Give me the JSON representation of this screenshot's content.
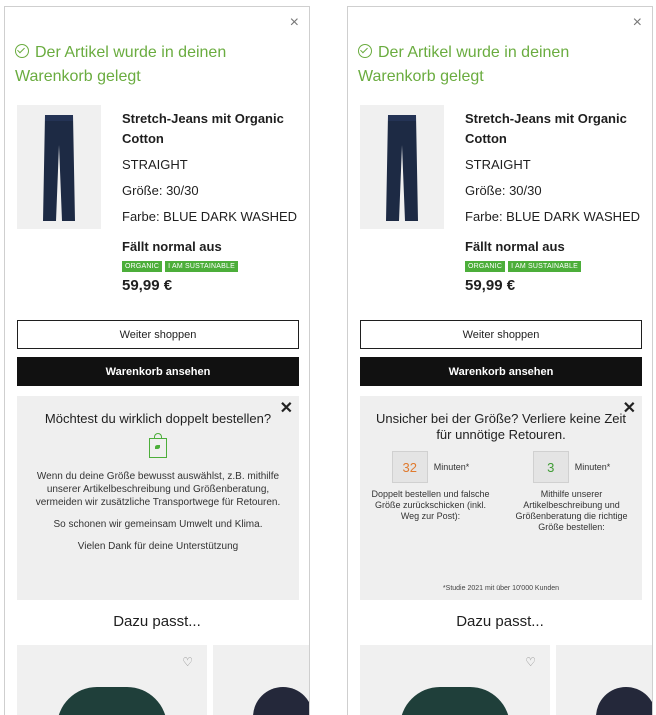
{
  "success_message": "Der Artikel wurde in deinen Warenkorb gelegt",
  "product": {
    "name": "Stretch-Jeans mit Organic Cotton",
    "fit": "STRAIGHT",
    "size_label": "Größe: 30/30",
    "color_label": "Farbe: BLUE DARK WASHED",
    "fit_note": "Fällt normal aus",
    "badges": [
      "ORGANIC",
      "I AM SUSTAINABLE"
    ],
    "price": "59,99 €"
  },
  "buttons": {
    "continue_shopping": "Weiter shoppen",
    "view_cart": "Warenkorb ansehen"
  },
  "left_box": {
    "title": "Möchtest du wirklich doppelt bestellen?",
    "paragraph1": "Wenn du deine Größe bewusst auswählst, z.B. mithilfe unserer Artikelbeschreibung und Größenberatung, vermeiden wir zusätzliche Transportwege für Retouren.",
    "paragraph2": "So schonen wir gemeinsam Umwelt und Klima.",
    "paragraph3": "Vielen Dank für deine Unterstützung"
  },
  "right_box": {
    "title": "Unsicher bei der Größe? Verliere keine Zeit für unnötige Retouren.",
    "stat1": {
      "value": "32",
      "unit": "Minuten*",
      "description": "Doppelt bestellen und falsche Größe zurückschicken (inkl. Weg zur Post):"
    },
    "stat2": {
      "value": "3",
      "unit": "Minuten*",
      "description": "Mithilfe unserer Artikelbeschreibung und Größenberatung die richtige Größe bestellen:"
    },
    "footnote": "*Studie 2021 mit über 10'000 Kunden"
  },
  "suggestions_title": "Dazu passt...",
  "colors": {
    "success_green": "#6aac3f",
    "badge_green": "#4cae3a",
    "stat_orange": "#e07a2e",
    "dark_button": "#111111",
    "info_box_bg": "#efefef"
  },
  "icons": {
    "close": "close-icon",
    "success": "check-circle-icon",
    "eco": "sustainable-bag-icon",
    "wishlist": "heart-icon"
  }
}
